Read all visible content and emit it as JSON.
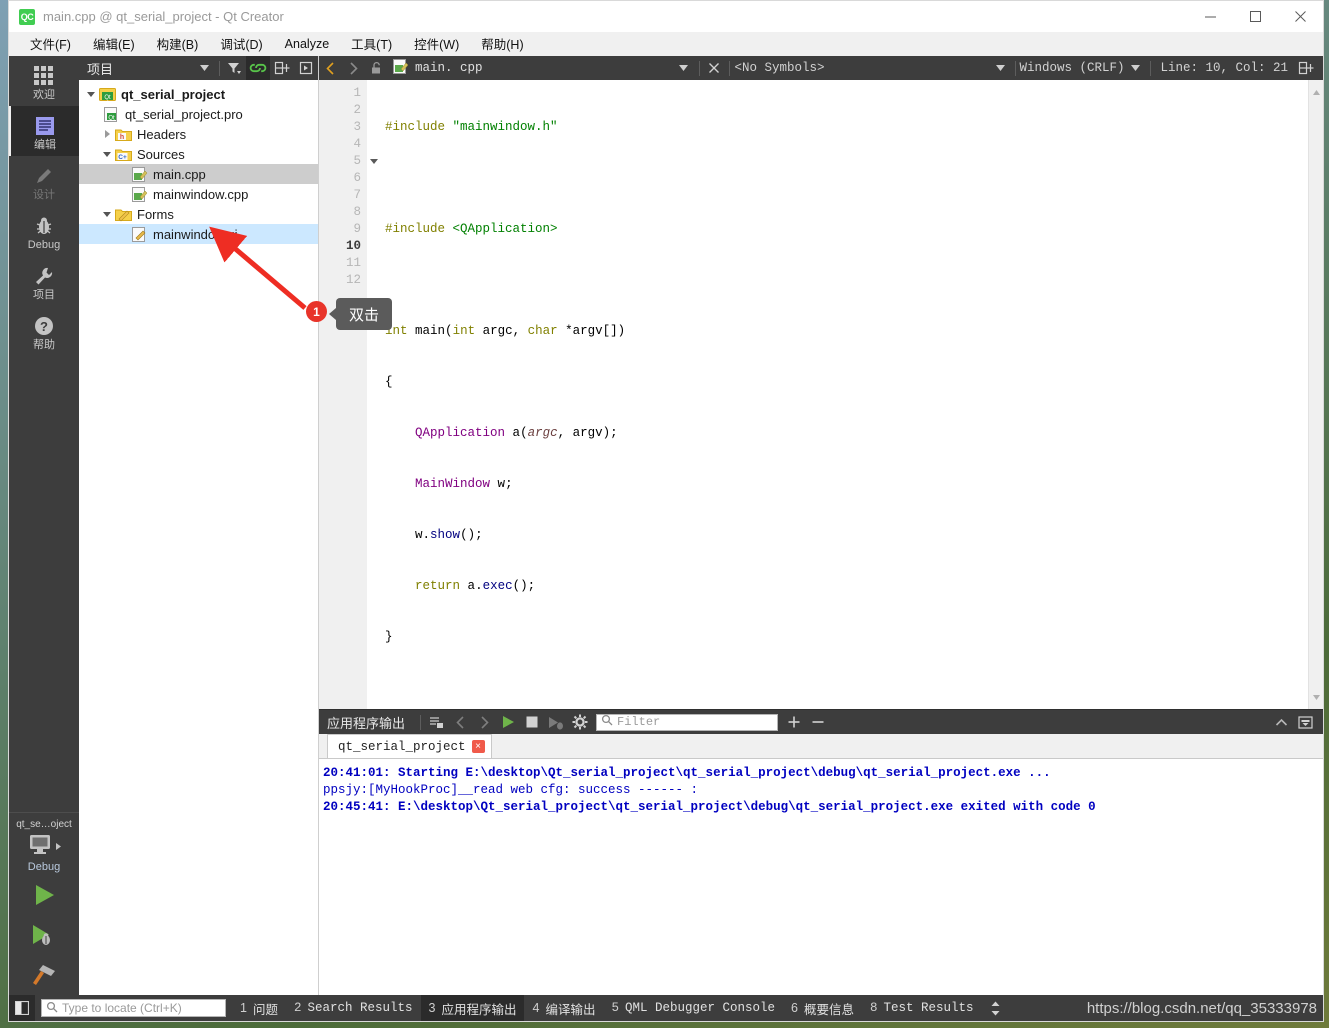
{
  "window": {
    "title": "main.cpp @ qt_serial_project - Qt Creator",
    "app_icon_text": "QC",
    "minimize": "minimize-icon",
    "maximize": "maximize-icon",
    "close": "close-icon"
  },
  "menubar": {
    "items": [
      {
        "label": "文件(F)",
        "mnemonic": "F"
      },
      {
        "label": "编辑(E)",
        "mnemonic": "E"
      },
      {
        "label": "构建(B)",
        "mnemonic": "B"
      },
      {
        "label": "调试(D)",
        "mnemonic": "D"
      },
      {
        "label": "Analyze",
        "mnemonic": "A"
      },
      {
        "label": "工具(T)",
        "mnemonic": "T"
      },
      {
        "label": "控件(W)",
        "mnemonic": "W"
      },
      {
        "label": "帮助(H)",
        "mnemonic": "H"
      }
    ]
  },
  "modebar": {
    "items": [
      {
        "label": "欢迎",
        "icon": "grid-icon",
        "state": "normal"
      },
      {
        "label": "编辑",
        "icon": "document-lines-icon",
        "state": "selected"
      },
      {
        "label": "设计",
        "icon": "pencil-icon",
        "state": "disabled"
      },
      {
        "label": "Debug",
        "icon": "bug-icon",
        "state": "normal"
      },
      {
        "label": "项目",
        "icon": "wrench-icon",
        "state": "normal"
      },
      {
        "label": "帮助",
        "icon": "question-circle-icon",
        "state": "normal"
      }
    ],
    "kit": {
      "project": "qt_se…oject",
      "config": "Debug",
      "target_icon": "monitor-icon",
      "run_label": "run-button",
      "debug_label": "debug-button",
      "build_label": "build-button"
    }
  },
  "sidebar": {
    "title": "项目",
    "buttons": [
      {
        "name": "filter-icon"
      },
      {
        "name": "link-icon"
      },
      {
        "name": "split-icon"
      },
      {
        "name": "close-icon"
      }
    ],
    "tree": [
      {
        "label": "qt_serial_project",
        "indent": 0,
        "twist": "down",
        "icon": "qt-project-icon",
        "bold": true,
        "selected": "none"
      },
      {
        "label": "qt_serial_project.pro",
        "indent": 1,
        "twist": "none",
        "icon": "pro-file-icon",
        "bold": false,
        "selected": "none"
      },
      {
        "label": "Headers",
        "indent": 1,
        "twist": "right",
        "icon": "headers-folder-icon",
        "bold": false,
        "selected": "none"
      },
      {
        "label": "Sources",
        "indent": 1,
        "twist": "down",
        "icon": "sources-folder-icon",
        "bold": false,
        "selected": "none"
      },
      {
        "label": "main.cpp",
        "indent": 2,
        "twist": "none",
        "icon": "cpp-file-icon",
        "bold": false,
        "selected": "grey"
      },
      {
        "label": "mainwindow.cpp",
        "indent": 2,
        "twist": "none",
        "icon": "cpp-file-icon",
        "bold": false,
        "selected": "none"
      },
      {
        "label": "Forms",
        "indent": 1,
        "twist": "down",
        "icon": "forms-folder-icon",
        "bold": false,
        "selected": "none"
      },
      {
        "label": "mainwindow.ui",
        "indent": 2,
        "twist": "none",
        "icon": "ui-file-icon",
        "bold": false,
        "selected": "blue"
      }
    ]
  },
  "editor_toolbar": {
    "back_icon": "arrow-left-icon",
    "forward_icon": "arrow-right-icon",
    "lock_icon": "unlock-icon",
    "file_icon": "cpp-file-icon",
    "filename": "main. cpp",
    "close_icon": "close-icon",
    "symbols": "<No Symbols>",
    "eol": "Windows (CRLF)",
    "line_col": "Line: 10, Col: 21",
    "split_icon": "split-icon"
  },
  "editor": {
    "lines": [
      {
        "n": 1,
        "fold": false,
        "current": false
      },
      {
        "n": 2,
        "fold": false,
        "current": false
      },
      {
        "n": 3,
        "fold": false,
        "current": false
      },
      {
        "n": 4,
        "fold": false,
        "current": false
      },
      {
        "n": 5,
        "fold": true,
        "current": false
      },
      {
        "n": 6,
        "fold": false,
        "current": false
      },
      {
        "n": 7,
        "fold": false,
        "current": false
      },
      {
        "n": 8,
        "fold": false,
        "current": false
      },
      {
        "n": 9,
        "fold": false,
        "current": false
      },
      {
        "n": 10,
        "fold": false,
        "current": true
      },
      {
        "n": 11,
        "fold": false,
        "current": false
      },
      {
        "n": 12,
        "fold": false,
        "current": false
      }
    ],
    "code_text": [
      "#include \"mainwindow.h\"",
      "",
      "#include <QApplication>",
      "",
      "int main(int argc, char *argv[])",
      "{",
      "    QApplication a(argc, argv);",
      "    MainWindow w;",
      "    w.show();",
      "    return a.exec();",
      "}",
      ""
    ]
  },
  "output_pane": {
    "title": "应用程序输出",
    "buttons": [
      {
        "name": "select-all-icon"
      },
      {
        "name": "prev-item-icon"
      },
      {
        "name": "next-item-icon"
      },
      {
        "name": "run-icon"
      },
      {
        "name": "stop-icon"
      },
      {
        "name": "attach-debugger-icon"
      },
      {
        "name": "settings-gear-icon"
      }
    ],
    "filter_placeholder": "Filter",
    "zoom_in": "+",
    "zoom_out": "−",
    "minimize_icon": "chevron-up-icon",
    "maximize_icon": "maximize-pane-icon",
    "tab": {
      "label": "qt_serial_project",
      "close": "×"
    },
    "lines": [
      {
        "text": "20:41:01: Starting E:\\desktop\\Qt_serial_project\\qt_serial_project\\debug\\qt_serial_project.exe ...",
        "style": "bold"
      },
      {
        "text": "ppsjy:[MyHookProc]__read web cfg: success ------ :",
        "style": "normal"
      },
      {
        "text": "20:45:41: E:\\desktop\\Qt_serial_project\\qt_serial_project\\debug\\qt_serial_project.exe exited with code 0",
        "style": "bold"
      }
    ]
  },
  "statusbar": {
    "toggle_sidebar_icon": "toggle-sidebar-icon",
    "locator_placeholder": "Type to locate (Ctrl+K)",
    "search_icon": "search-icon",
    "tabs": [
      {
        "num": "1",
        "label": "问题",
        "active": false,
        "zh": true
      },
      {
        "num": "2",
        "label": "Search Results",
        "active": false,
        "zh": false
      },
      {
        "num": "3",
        "label": "应用程序输出",
        "active": true,
        "zh": true
      },
      {
        "num": "4",
        "label": "编译输出",
        "active": false,
        "zh": true
      },
      {
        "num": "5",
        "label": "QML Debugger Console",
        "active": false,
        "zh": false
      },
      {
        "num": "6",
        "label": "概要信息",
        "active": false,
        "zh": true
      },
      {
        "num": "8",
        "label": "Test Results",
        "active": false,
        "zh": false
      }
    ],
    "updown_icon": "up-down-arrows-icon",
    "watermark": "https://blog.csdn.net/qq_35333978"
  },
  "annotation": {
    "badge_number": "1",
    "tooltip_text": "双击",
    "arrow_color": "#ee2d23"
  },
  "colors": {
    "dark_chrome": "#3d3d3d",
    "darker_chrome": "#2b2b2b",
    "selection_blue": "#cce8ff",
    "qt_green": "#41cd52",
    "output_blue": "#0000c0",
    "annotation_red": "#e8342a"
  }
}
